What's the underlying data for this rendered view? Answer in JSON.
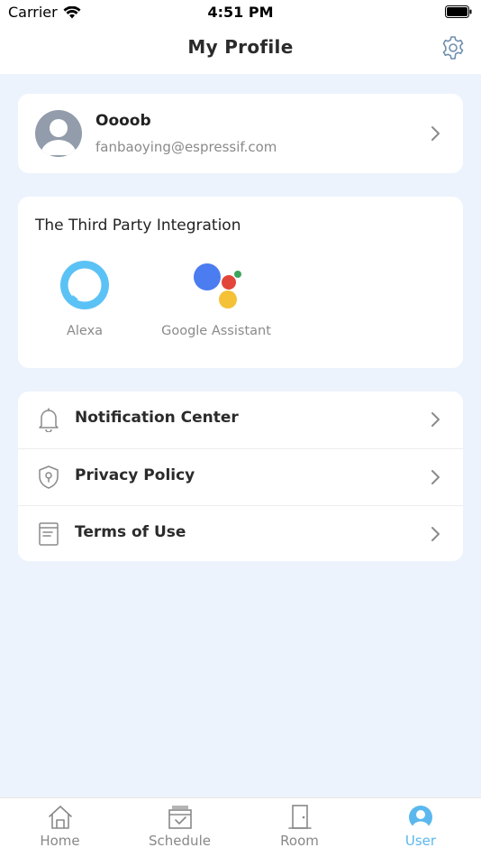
{
  "status_bar": {
    "carrier": "Carrier",
    "time": "4:51 PM"
  },
  "header": {
    "title": "My Profile",
    "settings_icon": "gear-icon"
  },
  "profile": {
    "name": "Oooob",
    "email": "fanbaoying@espressif.com"
  },
  "integration": {
    "title": "The Third Party Integration",
    "items": [
      {
        "label": "Alexa",
        "icon": "alexa-icon"
      },
      {
        "label": "Google Assistant",
        "icon": "google-assistant-icon"
      }
    ]
  },
  "menu": {
    "items": [
      {
        "label": "Notification Center",
        "icon": "bell-icon"
      },
      {
        "label": "Privacy Policy",
        "icon": "shield-icon"
      },
      {
        "label": "Terms of Use",
        "icon": "document-icon"
      }
    ]
  },
  "tabs": [
    {
      "label": "Home",
      "icon": "home-icon"
    },
    {
      "label": "Schedule",
      "icon": "calendar-icon"
    },
    {
      "label": "Room",
      "icon": "door-icon"
    },
    {
      "label": "User",
      "icon": "user-icon",
      "active": true
    }
  ],
  "colors": {
    "accent": "#5bb8ee",
    "background": "#edf3fd"
  }
}
